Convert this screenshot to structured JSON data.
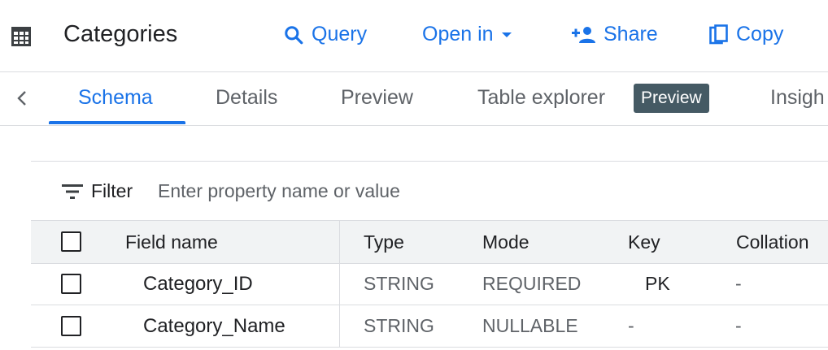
{
  "header": {
    "title": "Categories",
    "icon": "table-icon",
    "actions": [
      {
        "icon": "search-icon",
        "label": "Query"
      },
      {
        "icon": "chevron-down-icon",
        "label": "Open in"
      },
      {
        "icon": "person-add-icon",
        "label": "Share"
      },
      {
        "icon": "copy-icon",
        "label": "Copy"
      }
    ]
  },
  "tabs": {
    "items": [
      {
        "label": "Schema",
        "active": true
      },
      {
        "label": "Details"
      },
      {
        "label": "Preview"
      },
      {
        "label": "Table explorer"
      },
      {
        "label": "Insigh"
      }
    ],
    "badge": "Preview"
  },
  "filter": {
    "label": "Filter",
    "placeholder": "Enter property name or value"
  },
  "table": {
    "columns": [
      "Field name",
      "Type",
      "Mode",
      "Key",
      "Collation"
    ],
    "rows": [
      {
        "field": "Category_ID",
        "type": "STRING",
        "mode": "REQUIRED",
        "key": "PK",
        "collation": "-"
      },
      {
        "field": "Category_Name",
        "type": "STRING",
        "mode": "NULLABLE",
        "key": "-",
        "collation": "-"
      }
    ]
  },
  "colors": {
    "accent": "#1a73e8",
    "badge_bg": "#455a64",
    "header_bg": "#f1f3f4",
    "border": "#dadce0"
  }
}
